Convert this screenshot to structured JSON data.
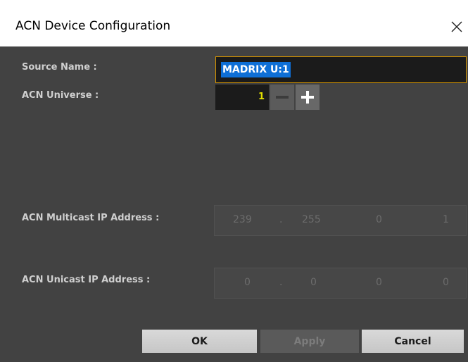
{
  "window": {
    "title": "ACN Device Configuration"
  },
  "labels": {
    "source_name": "Source Name :",
    "acn_universe": "ACN Universe :",
    "multicast": "ACN Multicast IP Address :",
    "unicast": "ACN Unicast IP Address :"
  },
  "source_name": {
    "value": "MADRIX U:1"
  },
  "universe": {
    "value": "1"
  },
  "multicast_ip": [
    "239",
    "255",
    "0",
    "1"
  ],
  "unicast_ip": [
    "0",
    "0",
    "0",
    "0"
  ],
  "ip_separator": ".",
  "buttons": {
    "ok": "OK",
    "apply": "Apply",
    "cancel": "Cancel"
  },
  "icons": {
    "close": "close-icon",
    "minus": "minus-icon",
    "plus": "plus-icon"
  },
  "colors": {
    "panel_bg": "#424242",
    "input_bg": "#1b1b1b",
    "focus_border": "#d49400",
    "selection": "#0e6fd6",
    "universe_value": "#e3e000",
    "label_text": "#cfcfcf"
  }
}
